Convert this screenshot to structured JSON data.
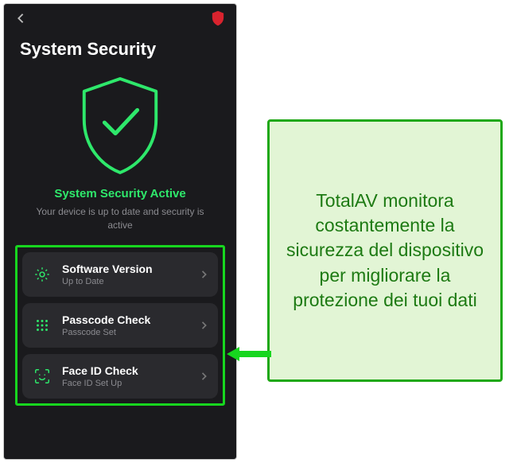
{
  "colors": {
    "accent_green": "#2ee86b",
    "highlight_green": "#17d61f",
    "brand_red": "#d9232e",
    "card_bg": "#2a2a2e",
    "page_bg": "#1a1a1d",
    "callout_bg": "#e2f5d5",
    "callout_border": "#1fa815",
    "callout_text": "#1d7a13"
  },
  "header": {
    "back_icon": "chevron-left",
    "brand_icon": "shield"
  },
  "page": {
    "title": "System Security",
    "status_title": "System Security Active",
    "status_sub": "Your device is up to date and security is active"
  },
  "cards": [
    {
      "icon": "gear-icon",
      "title": "Software Version",
      "sub": "Up to Date"
    },
    {
      "icon": "keypad-icon",
      "title": "Passcode Check",
      "sub": "Passcode Set"
    },
    {
      "icon": "face-id-icon",
      "title": "Face ID Check",
      "sub": "Face ID Set Up"
    }
  ],
  "callout": {
    "text": "TotalAV monitora costantemente la sicurezza del dispositivo per migliorare la protezione dei tuoi dati"
  }
}
